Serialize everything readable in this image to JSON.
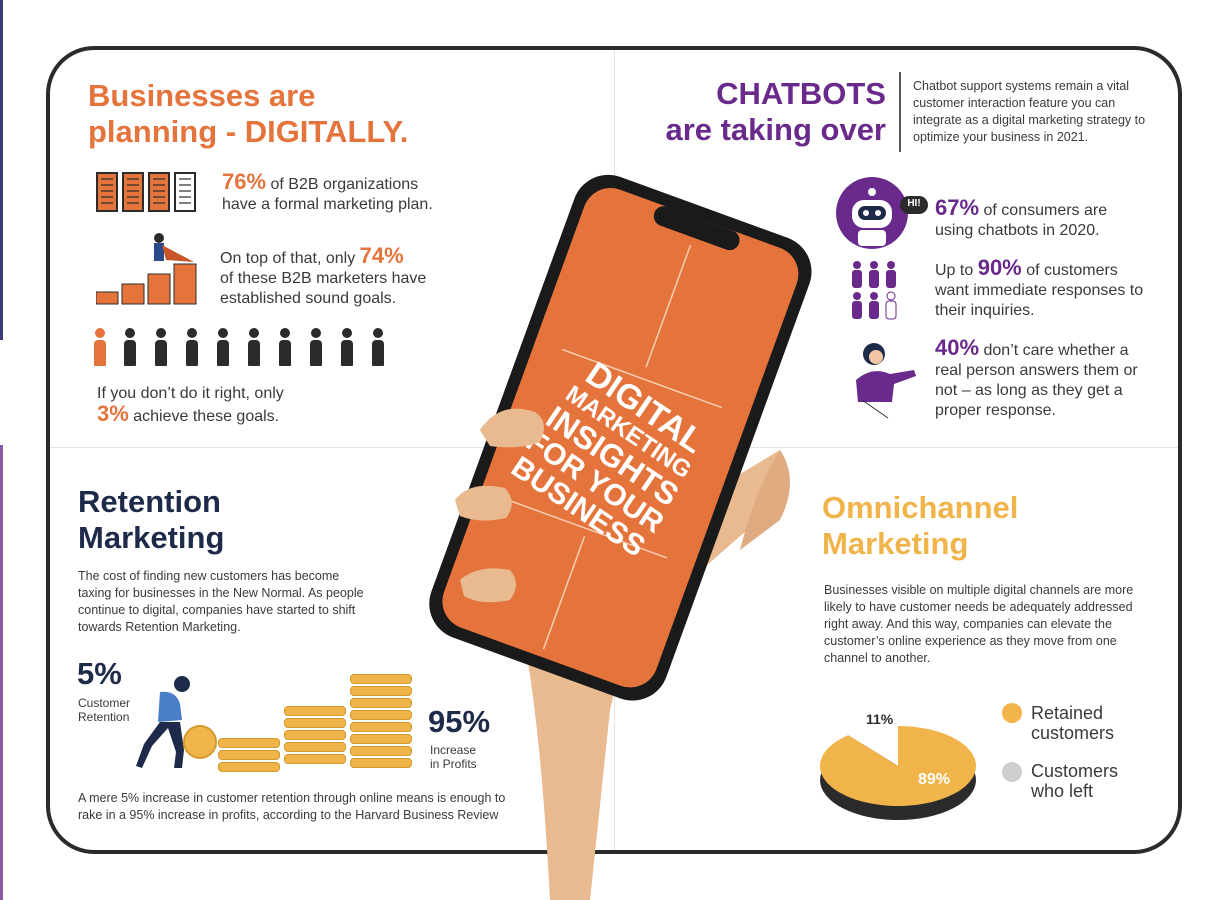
{
  "q1": {
    "title_line1": "Businesses are",
    "title_line2": "planning - DIGITALLY.",
    "stat1_pct": "76%",
    "stat1_text_a": "of B2B organizations",
    "stat1_text_b": "have a formal marketing plan.",
    "stat2_text_a": "On top of that, only",
    "stat2_pct": "74%",
    "stat2_text_b": "of these B2B marketers have",
    "stat2_text_c": "established sound goals.",
    "stat3_text_a": "If you don’t do it right, only",
    "stat3_pct": "3%",
    "stat3_text_b": "achieve these goals."
  },
  "q2": {
    "title_line1": "CHATBOTS",
    "title_line2": "are taking over",
    "intro": "Chatbot support systems remain a vital customer interaction feature you can integrate as a digital marketing strategy to optimize your business in 2021.",
    "bubble": "HI!",
    "stat1_pct": "67%",
    "stat1_text_a": "of consumers are",
    "stat1_text_b": "using chatbots in 2020.",
    "stat2_text_a": "Up to",
    "stat2_pct": "90%",
    "stat2_text_b": "of customers",
    "stat2_text_c": "want immediate responses to",
    "stat2_text_d": "their inquiries.",
    "stat3_pct": "40%",
    "stat3_text_a": "don’t care whether a",
    "stat3_text_b": "real person answers them or",
    "stat3_text_c": "not – as long as they get a",
    "stat3_text_d": "proper response."
  },
  "q3": {
    "title_line1": "Retention",
    "title_line2": "Marketing",
    "body": "The cost of finding new customers has become taxing for businesses in the New Normal. As people continue to digital, companies have started to shift towards Retention Marketing.",
    "left_pct": "5%",
    "left_label_a": "Customer",
    "left_label_b": "Retention",
    "right_pct": "95%",
    "right_label_a": "Increase",
    "right_label_b": "in Profits",
    "footer_a": "A mere 5% increase in customer retention through online means is enough to",
    "footer_b": "rake in a 95% increase in profits, according to the Harvard Business Review"
  },
  "q4": {
    "title_line1": "Omnichannel",
    "title_line2": "Marketing",
    "body": "Businesses visible on multiple digital channels are more likely to have customer needs be adequately addressed right away. And this way, companies can elevate the customer’s online experience as they move from one channel to another.",
    "legend_retained_a": "Retained",
    "legend_retained_b": "customers",
    "legend_left_a": "Customers",
    "legend_left_b": "who left",
    "colors": {
      "retained": "#f0b44a",
      "left": "#cfcfcf"
    }
  },
  "chart_data": {
    "type": "pie",
    "categories": [
      "Retained customers",
      "Customers who left"
    ],
    "values": [
      89,
      11
    ],
    "labels": [
      "89%",
      "11%"
    ]
  },
  "phone": {
    "screen_line1": "DIGITAL",
    "screen_line2": "MARKETING",
    "screen_line3": "INSIGHTS",
    "screen_line4": "FOR YOUR",
    "screen_line5": "BUSINESS",
    "screen_color": "#e4743c"
  }
}
